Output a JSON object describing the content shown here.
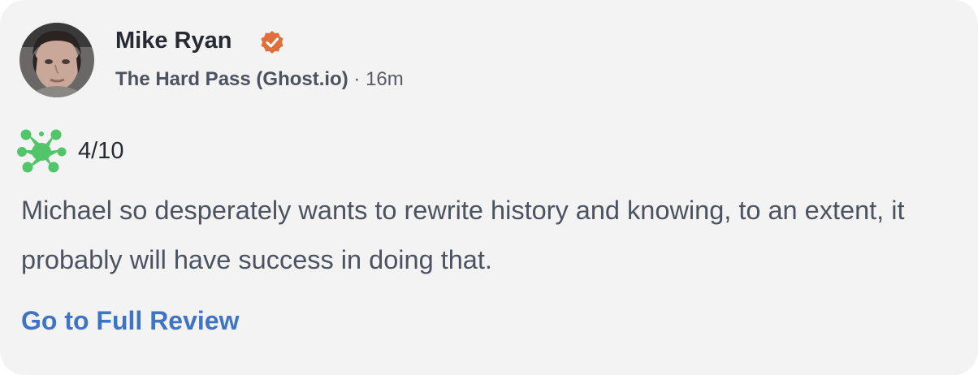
{
  "review": {
    "author": {
      "name": "Mike Ryan",
      "verified_icon": "verified-badge-icon",
      "avatar_icon": "reviewer-avatar"
    },
    "publication": "The Hard Pass (Ghost.io)",
    "separator": "·",
    "time": "16m",
    "score": {
      "icon": "rotten-splat-icon",
      "value": "4/10"
    },
    "quote": "Michael so desperately wants to rewrite history and knowing, to an extent, it probably will have success in doing that.",
    "link_label": "Go to Full Review"
  },
  "colors": {
    "card_background": "#f3f3f4",
    "verified_badge": "#e06f3b",
    "rotten_splat": "#52c46a",
    "link": "#3f74c4",
    "primary_text": "#262a33",
    "secondary_text": "#4b5260"
  }
}
